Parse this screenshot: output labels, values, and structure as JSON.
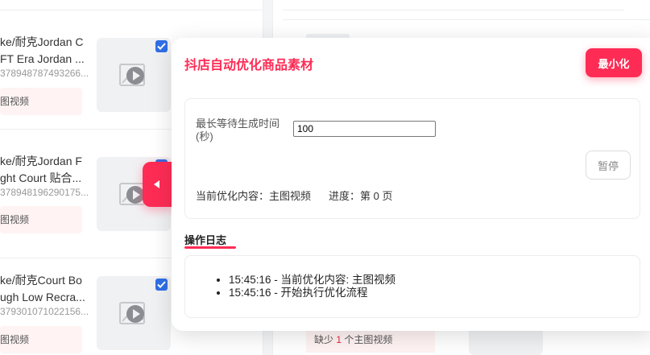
{
  "left_cards": [
    {
      "title_line1": "ke/耐克Jordan C",
      "title_line2": "FT Era Jordan ...",
      "id": "378948787493266...",
      "tag": "图视频"
    },
    {
      "title_line1": "ke/耐克Jordan F",
      "title_line2": "ght Court 贴合...",
      "id": "378948196290175...",
      "tag": "图视频"
    },
    {
      "title_line1": "ke/耐克Court Bo",
      "title_line2": "ugh Low Recra...",
      "id": "379301071022156...",
      "tag": "图视频"
    }
  ],
  "right_card": {
    "tag_prefix": "缺少",
    "tag_count": "1",
    "tag_suffix": "个主图视频"
  },
  "panel": {
    "title": "抖店自动优化商品素材",
    "minimize_label": "最小化",
    "wait_label": "最长等待生成时间(秒)",
    "wait_value": "100",
    "pause_label": "暂停",
    "current_label": "当前优化内容：主图视频",
    "progress_label": "进度：第 0 页",
    "log_title": "操作日志",
    "logs": [
      "15:45:16 - 当前优化内容: 主图视频",
      "15:45:16 - 开始执行优化流程"
    ]
  },
  "colors": {
    "accent": "#fe2c55",
    "checkbox": "#2f6fe6"
  }
}
